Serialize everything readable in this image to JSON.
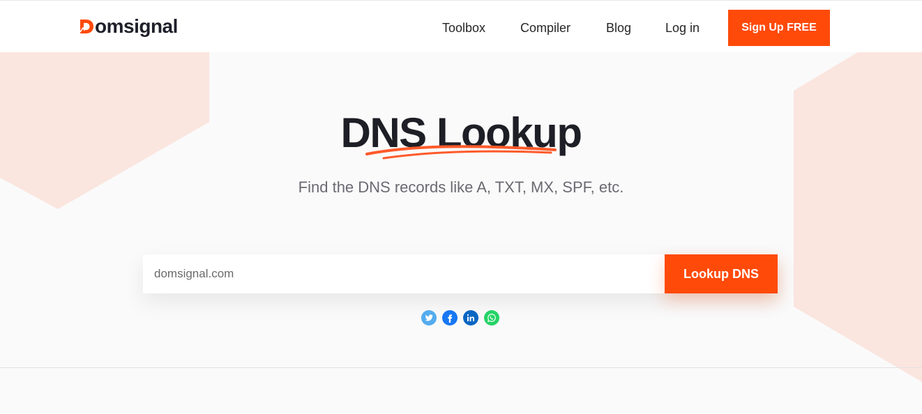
{
  "brand": {
    "name": "omsignal",
    "logo_letter": "D",
    "accent": "#ff4a09"
  },
  "nav": {
    "items": [
      {
        "label": "Toolbox"
      },
      {
        "label": "Compiler"
      },
      {
        "label": "Blog"
      },
      {
        "label": "Log in"
      }
    ],
    "signup_label": "Sign Up FREE"
  },
  "hero": {
    "title": "DNS Lookup",
    "subtitle": "Find the DNS records like A, TXT, MX, SPF, etc."
  },
  "search": {
    "placeholder": "domsignal.com",
    "button_label": "Lookup DNS"
  },
  "share": {
    "icons": [
      "twitter-icon",
      "facebook-icon",
      "linkedin-icon",
      "whatsapp-icon"
    ],
    "colors": {
      "twitter": "#55acee",
      "facebook": "#1877f2",
      "linkedin": "#0a66c2",
      "whatsapp": "#25d366"
    }
  }
}
